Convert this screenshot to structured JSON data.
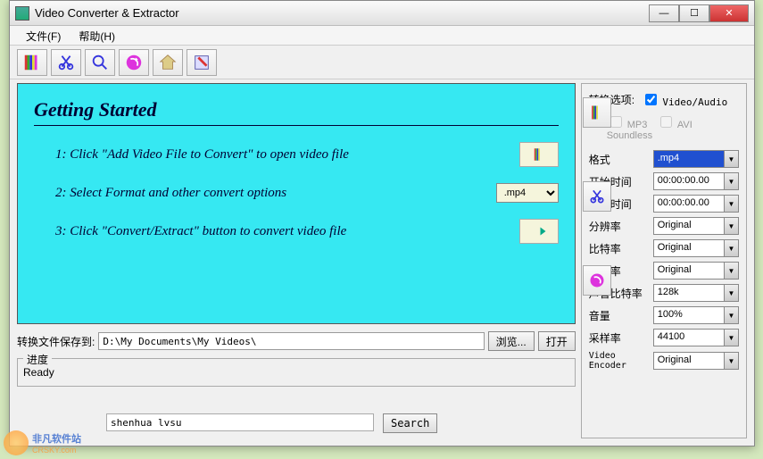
{
  "window": {
    "title": "Video Converter & Extractor"
  },
  "menu": {
    "file": "文件(F)",
    "help": "帮助(H)"
  },
  "tutorial": {
    "heading": "Getting Started",
    "step1": "1: Click \"Add Video File to Convert\" to open video file",
    "step2": "2: Select Format and other convert options",
    "step3": "3: Click \"Convert/Extract\" button to convert video file",
    "format_selected": ".mp4"
  },
  "save": {
    "label": "转换文件保存到:",
    "path": "D:\\My Documents\\My Videos\\",
    "browse": "浏览...",
    "open": "打开"
  },
  "progress": {
    "legend": "进度",
    "status": "Ready"
  },
  "options": {
    "title": "转换选项:",
    "video_audio": "Video/Audio",
    "mp3": "MP3",
    "avi_soundless": "AVI Soundless",
    "labels": {
      "format": "格式",
      "start": "开始时间",
      "duration": "持续时间",
      "resolution": "分辨率",
      "bitrate": "比特率",
      "fps": "帧速率",
      "audio_bitrate": "声音比特率",
      "volume": "音量",
      "sample_rate": "采样率",
      "encoder": "Video Encoder"
    },
    "values": {
      "format": ".mp4",
      "start": "00:00:00.00",
      "duration": "00:00:00.00",
      "resolution": "Original",
      "bitrate": "Original",
      "fps": "Original",
      "audio_bitrate": "128k",
      "volume": "100%",
      "sample_rate": "44100",
      "encoder": "Original"
    }
  },
  "search": {
    "value": "shenhua lvsu",
    "button": "Search"
  },
  "watermark": {
    "text": "非凡软件站",
    "url": "CRSKY.com"
  }
}
